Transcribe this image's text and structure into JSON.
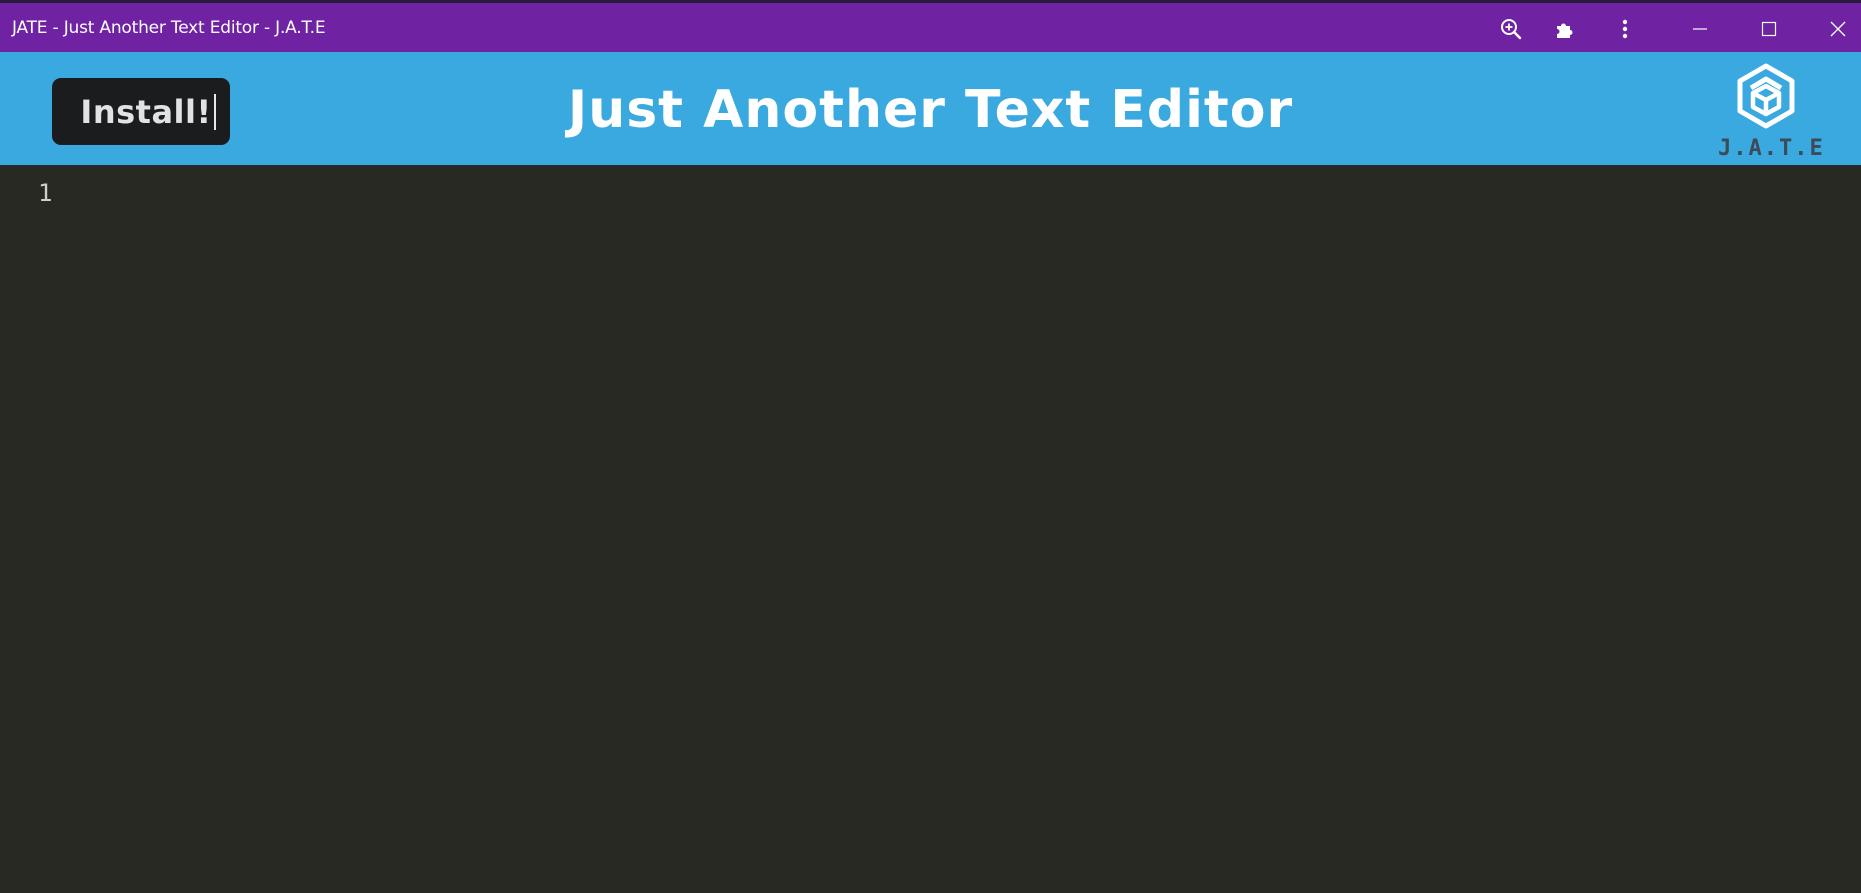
{
  "window": {
    "title": "JATE - Just Another Text Editor - J.A.T.E",
    "controls": {
      "zoom_icon": "zoom-in-icon",
      "extensions_icon": "puzzle-icon",
      "menu_icon": "more-vert-icon",
      "minimize_icon": "minimize-icon",
      "maximize_icon": "maximize-icon",
      "close_icon": "close-icon"
    },
    "colors": {
      "titlebar": "#6f22a2"
    }
  },
  "header": {
    "install_label": "Install!",
    "title": "Just Another Text Editor",
    "logo_text": "J.A.T.E",
    "colors": {
      "background": "#3aa9df",
      "button": "#1b1c1d"
    }
  },
  "editor": {
    "line_numbers": [
      "1"
    ],
    "content": "",
    "colors": {
      "background": "#282923"
    }
  }
}
